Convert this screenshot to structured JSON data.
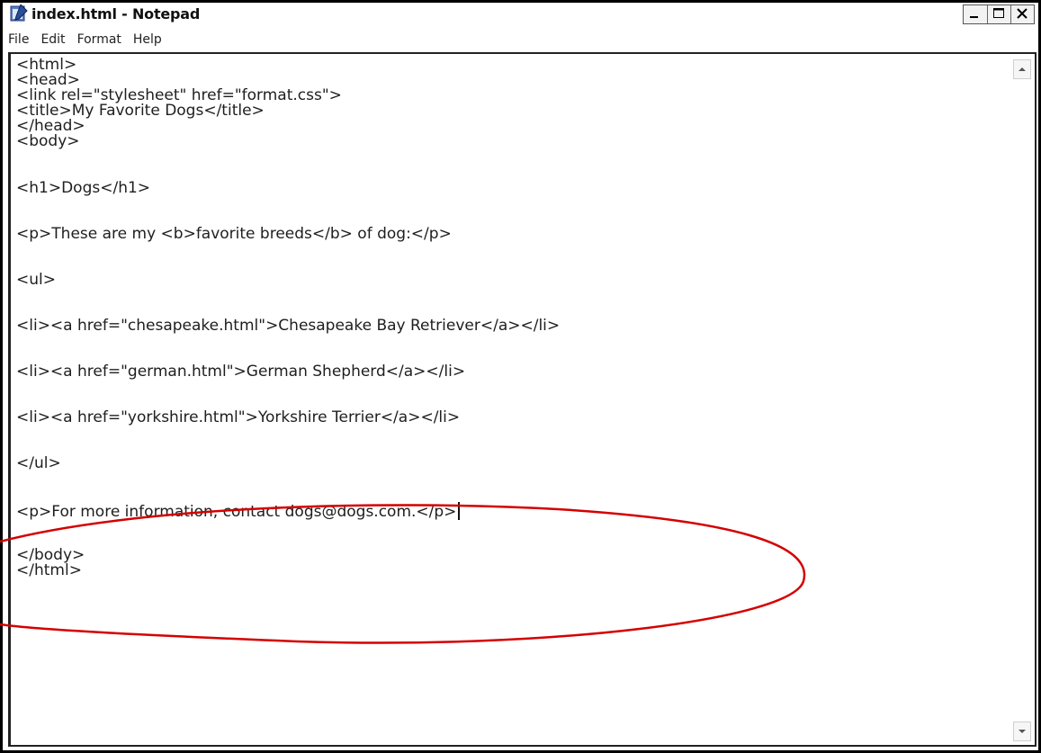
{
  "window": {
    "title": "index.html - Notepad"
  },
  "menu": {
    "items": [
      "File",
      "Edit",
      "Format",
      "Help"
    ]
  },
  "editor": {
    "lines": [
      "<html>",
      "<head>",
      "<link rel=\"stylesheet\" href=\"format.css\">",
      "<title>My Favorite Dogs</title>",
      "</head>",
      "<body>",
      "<h1>Dogs</h1>",
      "<p>These are my <b>favorite breeds</b> of dog:</p>",
      "<ul>",
      "<li><a href=\"chesapeake.html\">Chesapeake Bay Retriever</a></li>",
      "<li><a href=\"german.html\">German Shepherd</a></li>",
      "<li><a href=\"yorkshire.html\">Yorkshire Terrier</a></li>",
      "</ul>",
      "<p>For more information, contact dogs@dogs.com.</p>",
      "</body>",
      "</html>"
    ]
  },
  "colors": {
    "annotation": "#d40000",
    "text": "#1e1e1e"
  },
  "icons": {
    "app": "notepad-icon",
    "minimize": "minimize-icon",
    "maximize": "maximize-icon",
    "close": "close-icon",
    "scroll_up": "scroll-up-arrow-icon",
    "scroll_down": "scroll-down-arrow-icon"
  }
}
